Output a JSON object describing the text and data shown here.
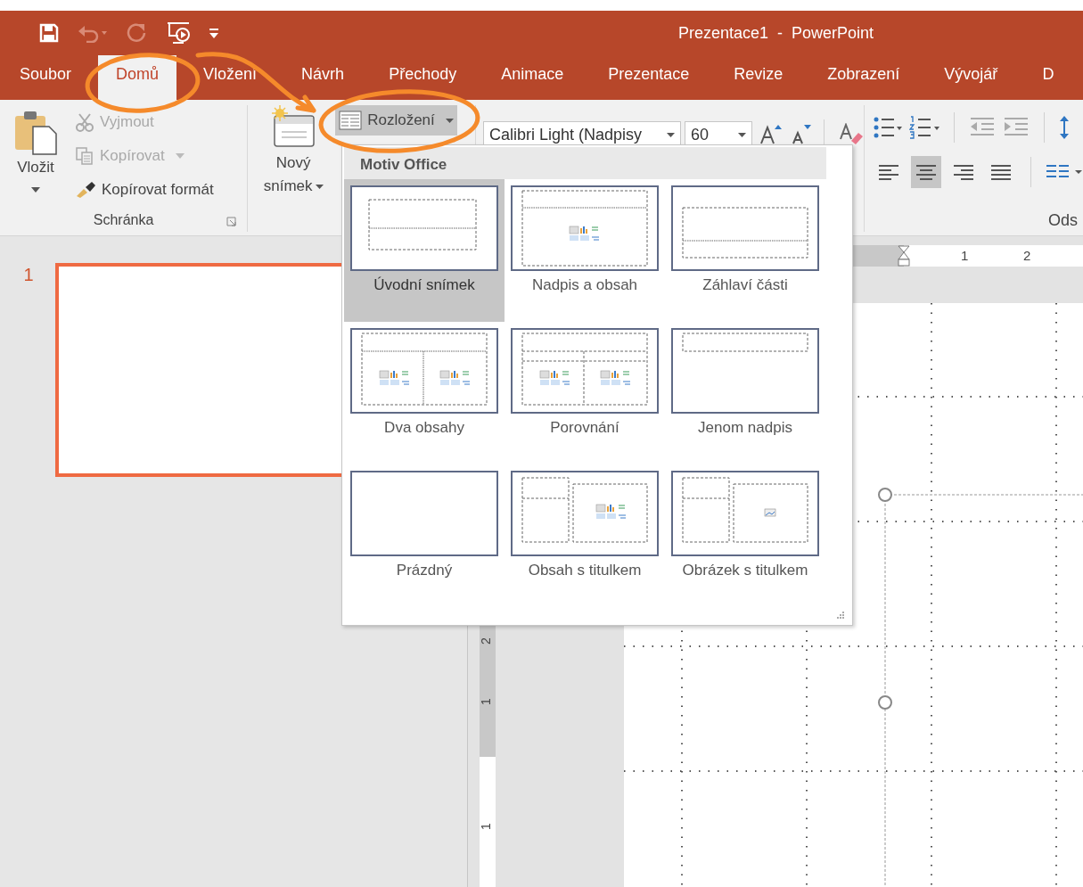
{
  "quick_access": [
    {
      "kind": "save",
      "disabled": false
    },
    {
      "kind": "undo",
      "disabled": true
    },
    {
      "kind": "redo",
      "disabled": true
    },
    {
      "kind": "slideshow",
      "disabled": false
    },
    {
      "kind": "customize",
      "disabled": false
    }
  ],
  "window": {
    "title": "Prezentace1  -  PowerPoint"
  },
  "tabs": [
    {
      "label": "Soubor",
      "selected": false
    },
    {
      "label": "Domů",
      "selected": true
    },
    {
      "label": "Vložení",
      "selected": false
    },
    {
      "label": "Návrh",
      "selected": false
    },
    {
      "label": "Přechody",
      "selected": false
    },
    {
      "label": "Animace",
      "selected": false
    },
    {
      "label": "Prezentace",
      "selected": false
    },
    {
      "label": "Revize",
      "selected": false
    },
    {
      "label": "Zobrazení",
      "selected": false
    },
    {
      "label": "Vývojář",
      "selected": false
    },
    {
      "label": "D",
      "selected": false
    }
  ],
  "clipboard": {
    "paste": "Vložit",
    "cut": {
      "label": "Vyjmout",
      "disabled": true
    },
    "copy": {
      "label": "Kopírovat",
      "disabled": true
    },
    "format_painter": {
      "label": "Kopírovat formát",
      "disabled": false
    },
    "group_label": "Schránka"
  },
  "slides_group": {
    "new_slide": "Nový snímek",
    "layout": {
      "label": "Rozložení",
      "open": true
    }
  },
  "font": {
    "name": "Calibri Light (Nadpisy",
    "size": "60"
  },
  "paragraph": {
    "alignment": [
      {
        "kind": "left",
        "selected": false
      },
      {
        "kind": "center",
        "selected": true
      },
      {
        "kind": "right",
        "selected": false
      },
      {
        "kind": "justify",
        "selected": false
      }
    ],
    "group_label": "Ods"
  },
  "layout_menu": {
    "header": "Motiv Office",
    "layouts": [
      {
        "label": "Úvodní snímek",
        "kind": "title",
        "selected": true
      },
      {
        "label": "Nadpis a obsah",
        "kind": "title-content",
        "selected": false
      },
      {
        "label": "Záhlaví části",
        "kind": "section",
        "selected": false
      },
      {
        "label": "Dva obsahy",
        "kind": "two-content",
        "selected": false
      },
      {
        "label": "Porovnání",
        "kind": "comparison",
        "selected": false
      },
      {
        "label": "Jenom nadpis",
        "kind": "title-only",
        "selected": false
      },
      {
        "label": "Prázdný",
        "kind": "blank",
        "selected": false
      },
      {
        "label": "Obsah s titulkem",
        "kind": "content-caption",
        "selected": false
      },
      {
        "label": "Obrázek s titulkem",
        "kind": "picture-caption",
        "selected": false
      }
    ]
  },
  "thumbnails": [
    {
      "number": "1",
      "selected": true
    }
  ],
  "horizontal_ruler": {
    "marks": [
      "1",
      "2"
    ]
  },
  "vertical_ruler": {
    "marks": [
      "2",
      "1",
      "1"
    ]
  }
}
